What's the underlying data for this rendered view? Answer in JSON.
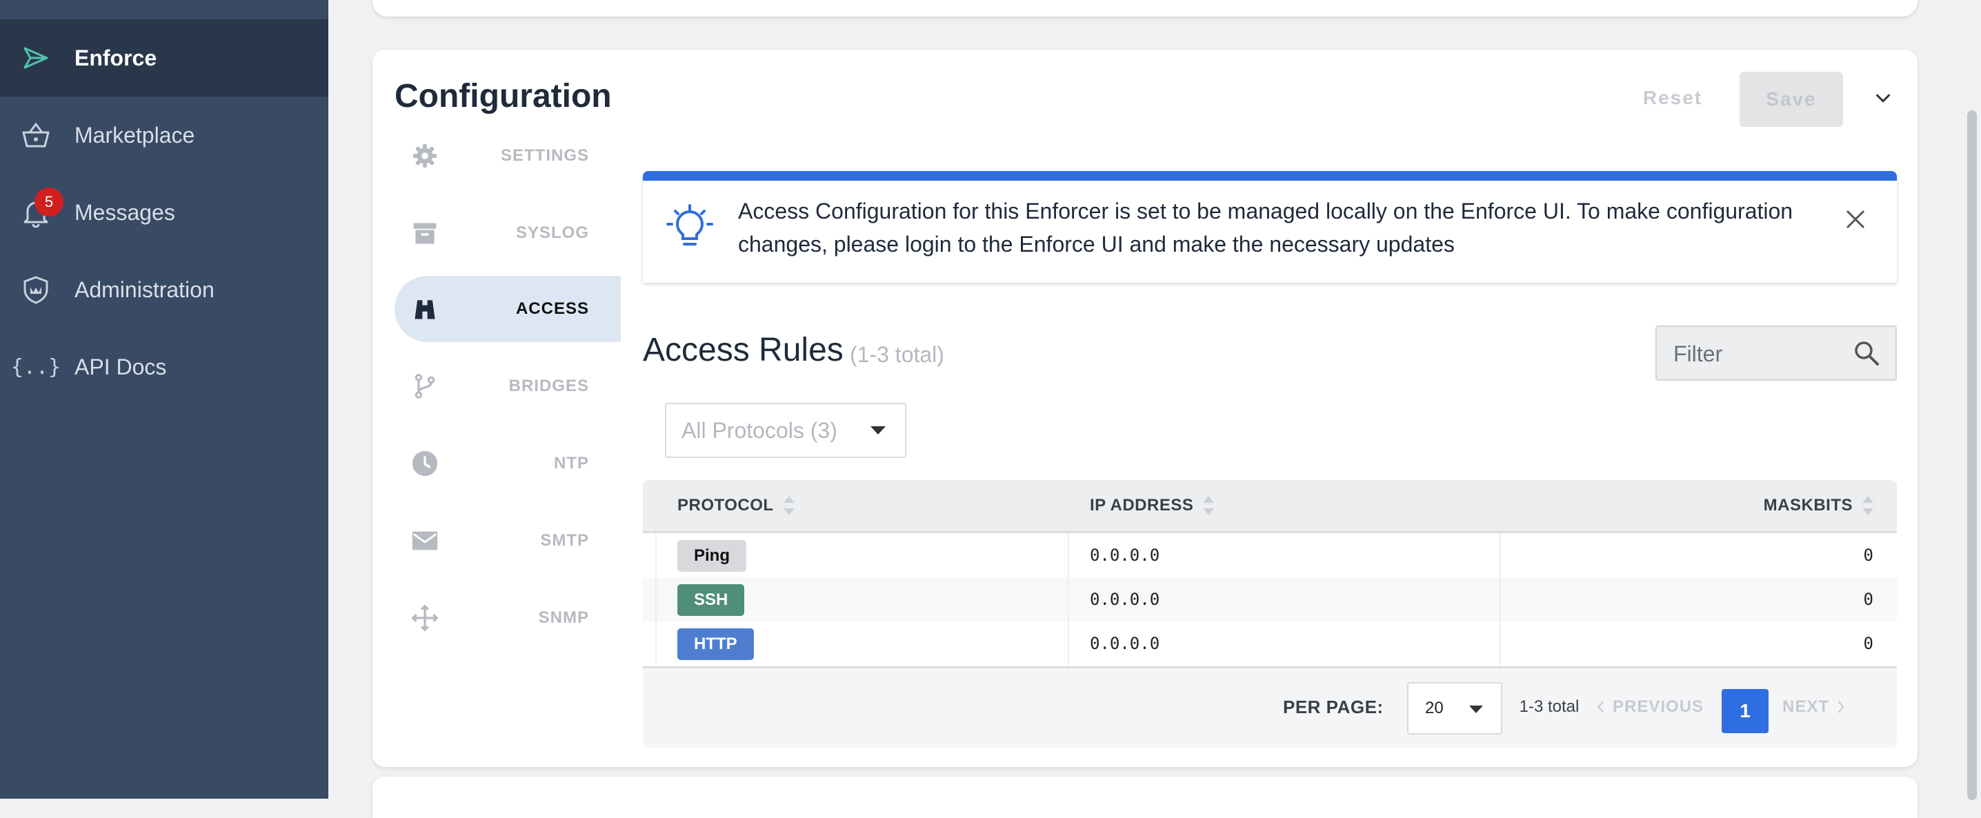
{
  "sidebar": {
    "items": [
      {
        "label": "Enforce",
        "icon": "enforce-logo-icon",
        "active": true
      },
      {
        "label": "Marketplace",
        "icon": "basket-icon"
      },
      {
        "label": "Messages",
        "icon": "bell-icon",
        "badge": "5"
      },
      {
        "label": "Administration",
        "icon": "shield-crown-icon"
      },
      {
        "label": "API Docs",
        "icon": "braces-icon",
        "icon_text": "{..}"
      }
    ]
  },
  "configuration": {
    "title": "Configuration",
    "reset_label": "Reset",
    "save_label": "Save",
    "nav": [
      {
        "label": "SETTINGS",
        "icon": "gear-icon"
      },
      {
        "label": "SYSLOG",
        "icon": "archive-icon"
      },
      {
        "label": "ACCESS",
        "icon": "binoculars-icon",
        "active": true
      },
      {
        "label": "BRIDGES",
        "icon": "branch-icon"
      },
      {
        "label": "NTP",
        "icon": "clock-icon"
      },
      {
        "label": "SMTP",
        "icon": "mail-icon"
      },
      {
        "label": "SNMP",
        "icon": "move-arrows-icon"
      }
    ],
    "alert": {
      "text": "Access Configuration for this Enforcer is set to be managed locally on the Enforce UI. To make configuration changes, please login to the Enforce UI and make the necessary updates"
    }
  },
  "access_rules": {
    "title": "Access Rules",
    "count": "(1-3 total)",
    "filter_placeholder": "Filter",
    "protocol_filter": "All Protocols (3)",
    "columns": [
      "PROTOCOL",
      "IP ADDRESS",
      "MASKBITS"
    ],
    "rows": [
      {
        "protocol": "Ping",
        "ip": "0.0.0.0",
        "maskbits": "0"
      },
      {
        "protocol": "SSH",
        "ip": "0.0.0.0",
        "maskbits": "0"
      },
      {
        "protocol": "HTTP",
        "ip": "0.0.0.0",
        "maskbits": "0"
      }
    ],
    "protocol_colors": {
      "Ping": "#d7d9dc",
      "SSH": "#4f8f78",
      "HTTP": "#4f7ed1"
    },
    "pagination": {
      "per_page_label": "PER PAGE:",
      "per_page": "20",
      "range": "1-3 total",
      "previous": "PREVIOUS",
      "current_page": "1",
      "next": "NEXT"
    }
  },
  "colors": {
    "sidebar_bg": "#384a64",
    "sidebar_active_bg": "#2a374a",
    "accent": "#2f6ee0",
    "badge": "#d11f1f"
  }
}
